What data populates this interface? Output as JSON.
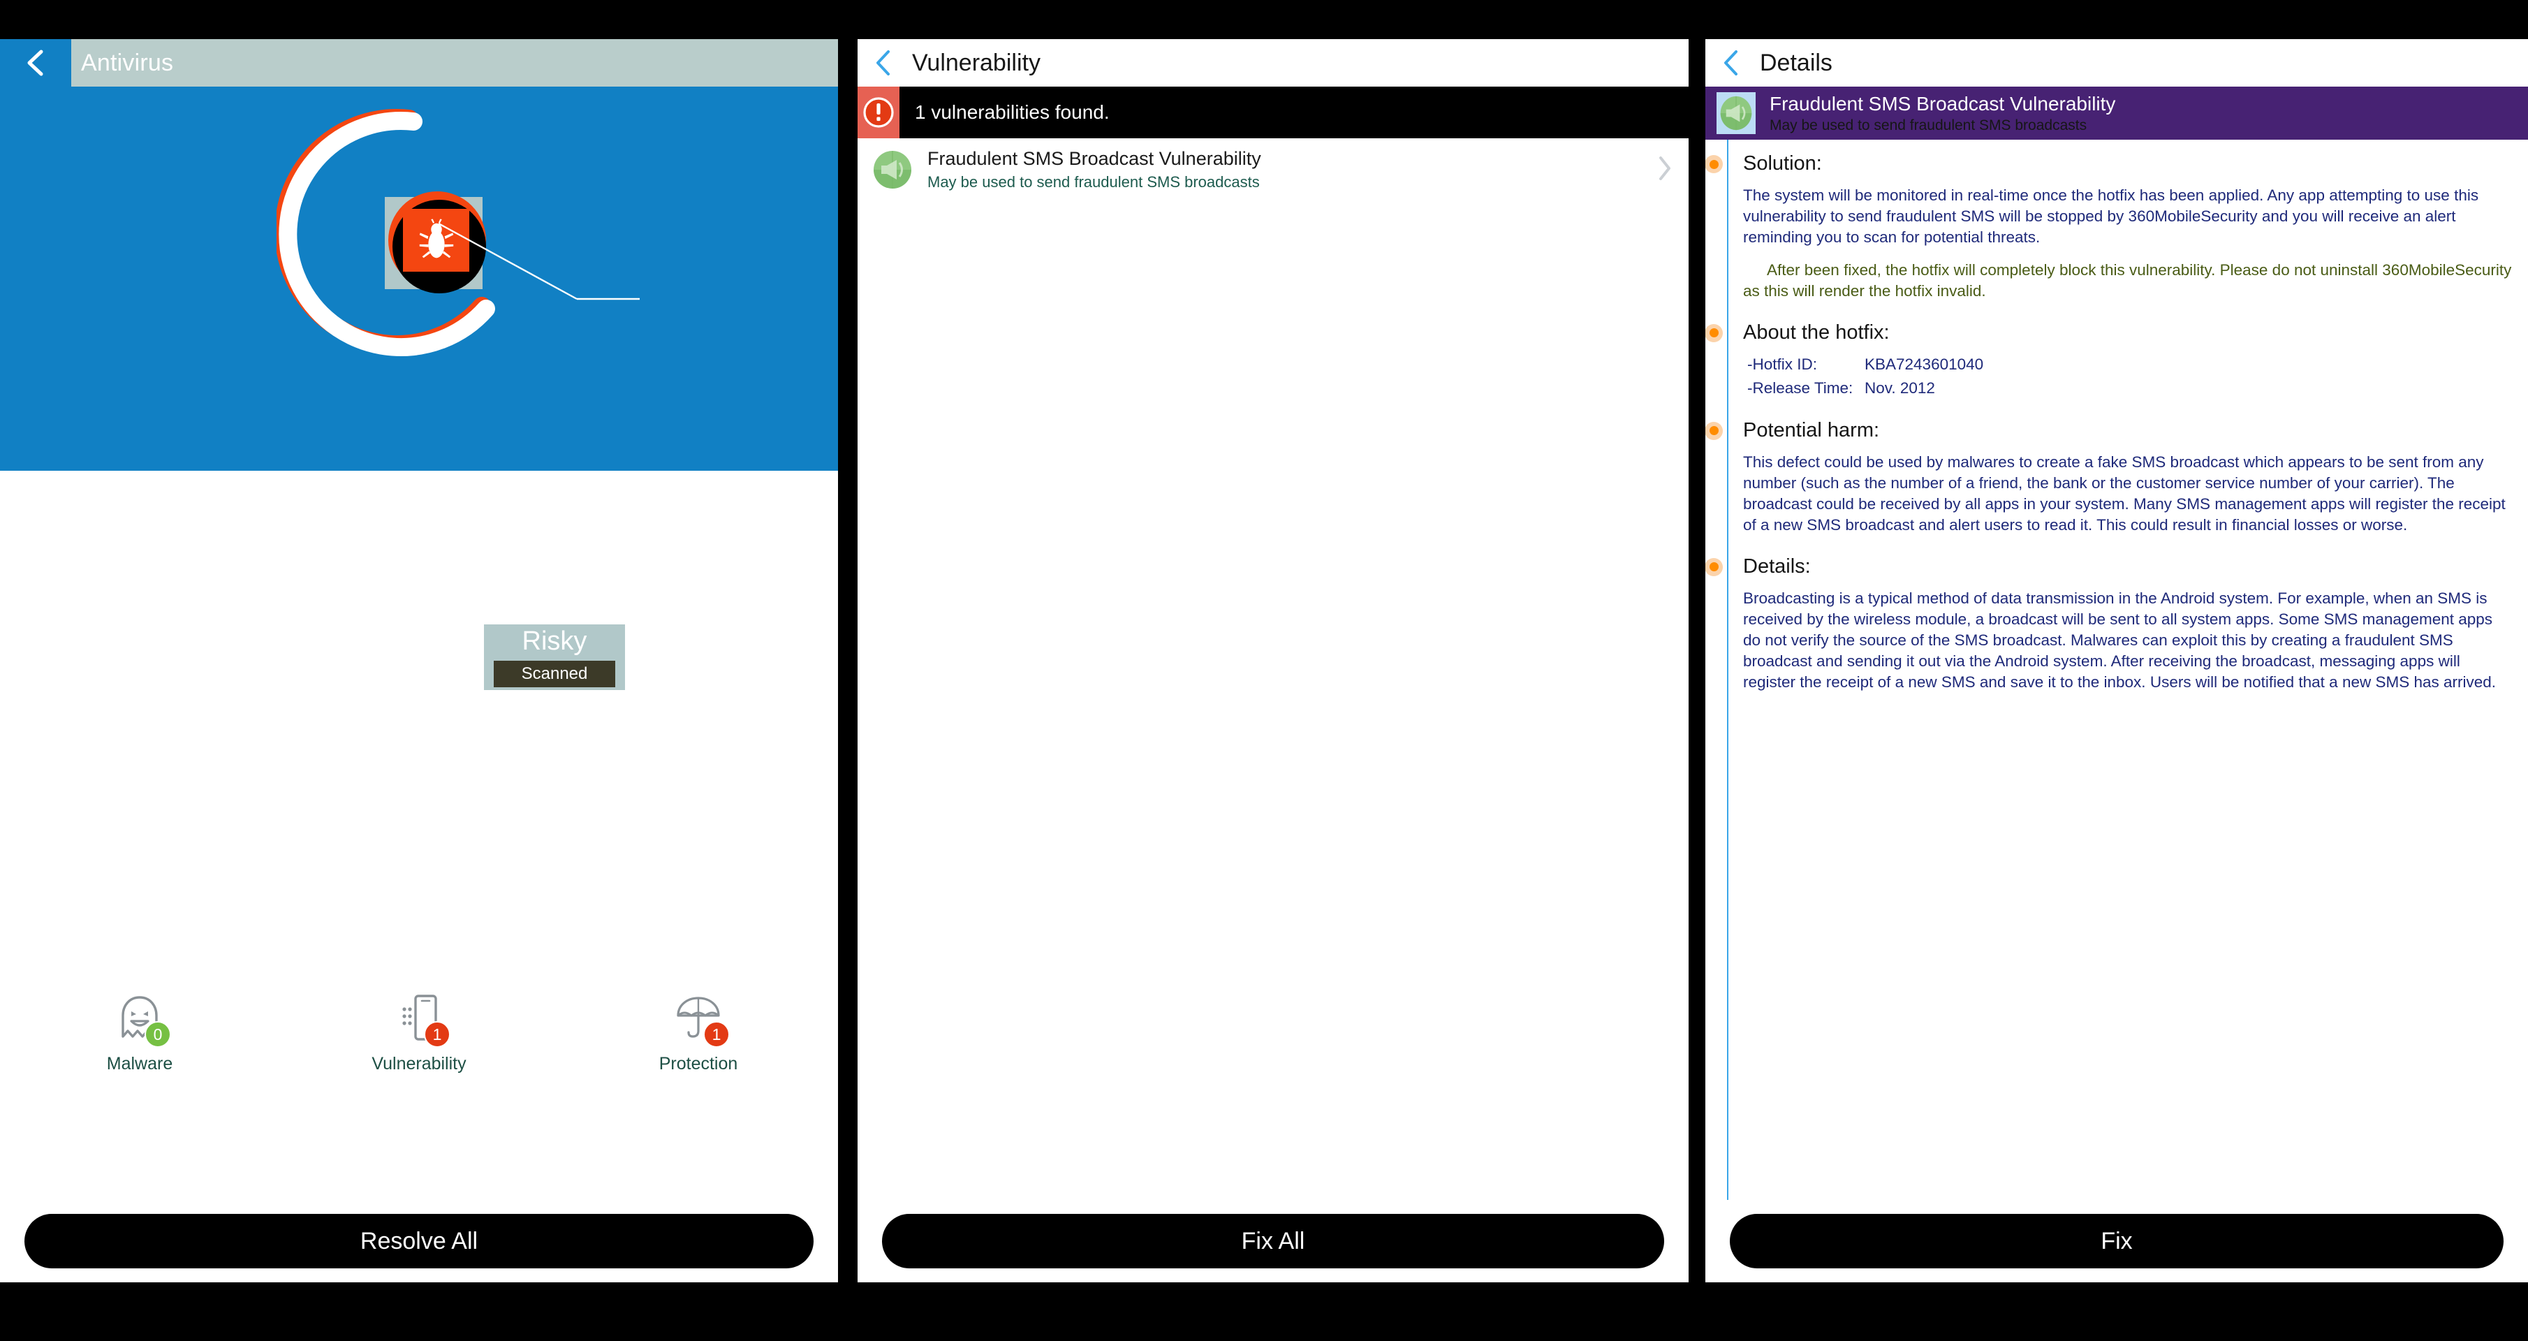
{
  "panels": {
    "antivirus": {
      "header": {
        "title": "Antivirus",
        "back_icon": "chevron-left-icon"
      },
      "scanner": {
        "status_label": "Risky",
        "scan_state_label": "Scanned",
        "center_icon": "bug-icon",
        "ring_progress_percent": 75,
        "ring_color": "#ffffff",
        "ring_accent_color": "#f44611",
        "background_color": "#1180c4"
      },
      "stats": [
        {
          "label": "Malware",
          "count": "0",
          "icon": "ghost-icon",
          "badge_color": "#76c043"
        },
        {
          "label": "Vulnerability",
          "count": "1",
          "icon": "phone-icon",
          "badge_color": "#e33a14"
        },
        {
          "label": "Protection",
          "count": "1",
          "icon": "umbrella-icon",
          "badge_color": "#e33a14"
        }
      ],
      "cta_label": "Resolve All"
    },
    "vulnerability": {
      "header": {
        "title": "Vulnerability",
        "back_icon": "chevron-left-icon"
      },
      "banner": {
        "text": "1 vulnerabilities found.",
        "icon": "alert-exclamation-icon",
        "icon_bg": "#e66153"
      },
      "list": [
        {
          "title": "Fraudulent SMS Broadcast Vulnerability",
          "subtitle": "May be used to send fraudulent SMS broadcasts",
          "icon": "megaphone-puzzle-icon",
          "chevron": "chevron-right-icon"
        }
      ],
      "cta_label": "Fix All"
    },
    "details": {
      "header": {
        "title": "Details",
        "back_icon": "chevron-left-icon"
      },
      "banner": {
        "title": "Fraudulent SMS Broadcast Vulnerability",
        "subtitle": "May be used to send fraudulent SMS broadcasts",
        "icon": "megaphone-puzzle-icon",
        "background_color": "#472273"
      },
      "sections": {
        "solution": {
          "heading": "Solution:",
          "paragraph_1": "The system will be monitored in real-time once the hotfix has been applied. Any app attempting to use this vulnerability to send fraudulent SMS will be stopped by 360MobileSecurity and you will receive an alert reminding you to scan for potential threats.",
          "paragraph_2": "After been fixed, the hotfix will completely block this vulnerability. Please do not uninstall 360MobileSecurity as this will render the hotfix invalid."
        },
        "about_hotfix": {
          "heading": "About the hotfix:",
          "hotfix_id_label": "-Hotfix ID:",
          "hotfix_id_value": "KBA7243601040",
          "release_time_label": "-Release Time:",
          "release_time_value": "Nov. 2012"
        },
        "potential_harm": {
          "heading": "Potential harm:",
          "paragraph": "This defect could be used by malwares to create a fake SMS broadcast which appears to be sent from any number (such as the number of a friend, the bank or the customer service number of your carrier). The broadcast could be received by all apps in your system. Many SMS management apps will register the receipt of a new SMS broadcast and alert users to read it. This could result in financial losses or worse."
        },
        "details": {
          "heading": "Details:",
          "paragraph": "Broadcasting is a typical method of data transmission in the Android system. For example, when an SMS is received by the wireless module, a broadcast will be sent to all system apps. Some SMS management apps do not verify the source of the SMS broadcast. Malwares can exploit this by creating a fraudulent SMS broadcast and sending it out via the Android system. After receiving the broadcast, messaging apps will register the receipt of a new SMS and save it to the inbox. Users will be notified that a new SMS has arrived."
        }
      },
      "cta_label": "Fix"
    }
  }
}
